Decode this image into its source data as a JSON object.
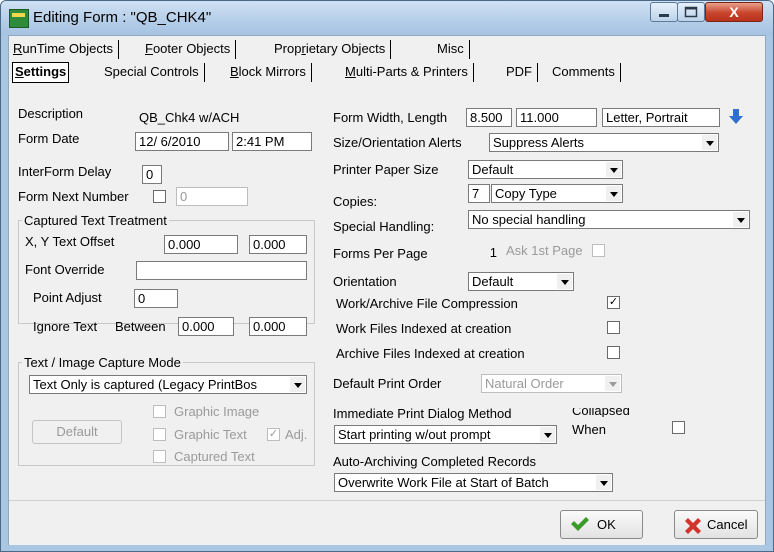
{
  "window": {
    "title": "Editing Form : \"QB_CHK4\"",
    "close_glyph": "X",
    "min_icon": "minimize-icon",
    "max_icon": "maximize-icon"
  },
  "tabs_top": [
    {
      "pre": "",
      "ul": "R",
      "post": "unTime Objects"
    },
    {
      "pre": "",
      "ul": "F",
      "post": "ooter Objects"
    },
    {
      "pre": "Prop",
      "ul": "r",
      "post": "ietary Objects"
    },
    {
      "pre": "Misc",
      "ul": "",
      "post": ""
    }
  ],
  "tabs_bottom": [
    {
      "pre": "",
      "ul": "S",
      "post": "ettings"
    },
    {
      "pre": "Special Controls",
      "ul": "",
      "post": ""
    },
    {
      "pre": "",
      "ul": "B",
      "post": "lock Mirrors"
    },
    {
      "pre": "",
      "ul": "M",
      "post": "ulti-Parts & Printers"
    },
    {
      "pre": "PDF",
      "ul": "",
      "post": ""
    },
    {
      "pre": "Comments",
      "ul": "",
      "post": ""
    }
  ],
  "left": {
    "description_label": "Description",
    "description_value": "QB_Chk4 w/ACH",
    "form_date_label": "Form Date",
    "form_date_value": "12/ 6/2010",
    "form_time_value": "2:41 PM",
    "interform_delay_label": "InterForm Delay",
    "interform_delay_value": "0",
    "form_next_number_label": "Form Next Number",
    "form_next_number_value": "0",
    "captured_group_title": "Captured Text Treatment",
    "xy_offset_label": "X, Y Text Offset",
    "x_offset_value": "0.000",
    "y_offset_value": "0.000",
    "font_override_label": "Font Override",
    "font_override_value": "",
    "point_adjust_label": "Point Adjust",
    "point_adjust_value": "0",
    "ignore_text_label": "Ignore Text",
    "between_label": "Between",
    "ignore_from_value": "0.000",
    "ignore_to_value": "0.000",
    "capture_group_title": "Text / Image Capture Mode",
    "capture_mode_value": "Text Only is captured (Legacy PrintBos",
    "default_button": "Default",
    "graphic_image_label": "Graphic Image",
    "graphic_text_label": "Graphic Text",
    "adj_label": "Adj.",
    "captured_text_label": "Captured Text"
  },
  "right": {
    "form_width_label": "Form Width, Length",
    "form_width_value": "8.500",
    "form_length_value": "11.000",
    "paper_desc_value": "Letter, Portrait",
    "size_alerts_label": "Size/Orientation Alerts",
    "size_alerts_value": "Suppress Alerts",
    "printer_paper_label": "Printer Paper Size",
    "printer_paper_value": "Default",
    "copies_label": "Copies:",
    "copies_value": "7",
    "copy_type_value": "Copy Type",
    "special_handling_label": "Special Handling:",
    "special_handling_value": "No special handling",
    "forms_per_page_label": "Forms Per Page",
    "forms_per_page_value": "1",
    "ask_first_page_label": "Ask 1st Page",
    "orientation_label": "Orientation",
    "orientation_value": "Default",
    "work_compression_label": "Work/Archive File Compression",
    "work_indexed_label": "Work Files Indexed at creation",
    "archive_indexed_label": "Archive Files Indexed at creation",
    "default_print_order_label": "Default Print Order",
    "default_print_order_value": "Natural Order",
    "immediate_print_label": "Immediate Print Dialog Method",
    "immediate_print_value": "Start printing w/out prompt",
    "collapsed_label": "Collapsed",
    "when_label": "When",
    "auto_archive_label": "Auto-Archiving Completed Records",
    "auto_archive_value": "Overwrite Work File at Start of Batch",
    "check_glyph": "✓",
    "arrow_icon": "arrow-down-icon"
  },
  "buttons": {
    "ok": "OK",
    "cancel": "Cancel",
    "ok_icon": "checkmark-icon",
    "cancel_icon": "cancel-x-icon"
  },
  "colors": {
    "title_bar": "#b4cde8",
    "ok_green": "#3a9a2a",
    "cancel_red": "#d0342c",
    "arrow_blue": "#2f6fd0"
  }
}
